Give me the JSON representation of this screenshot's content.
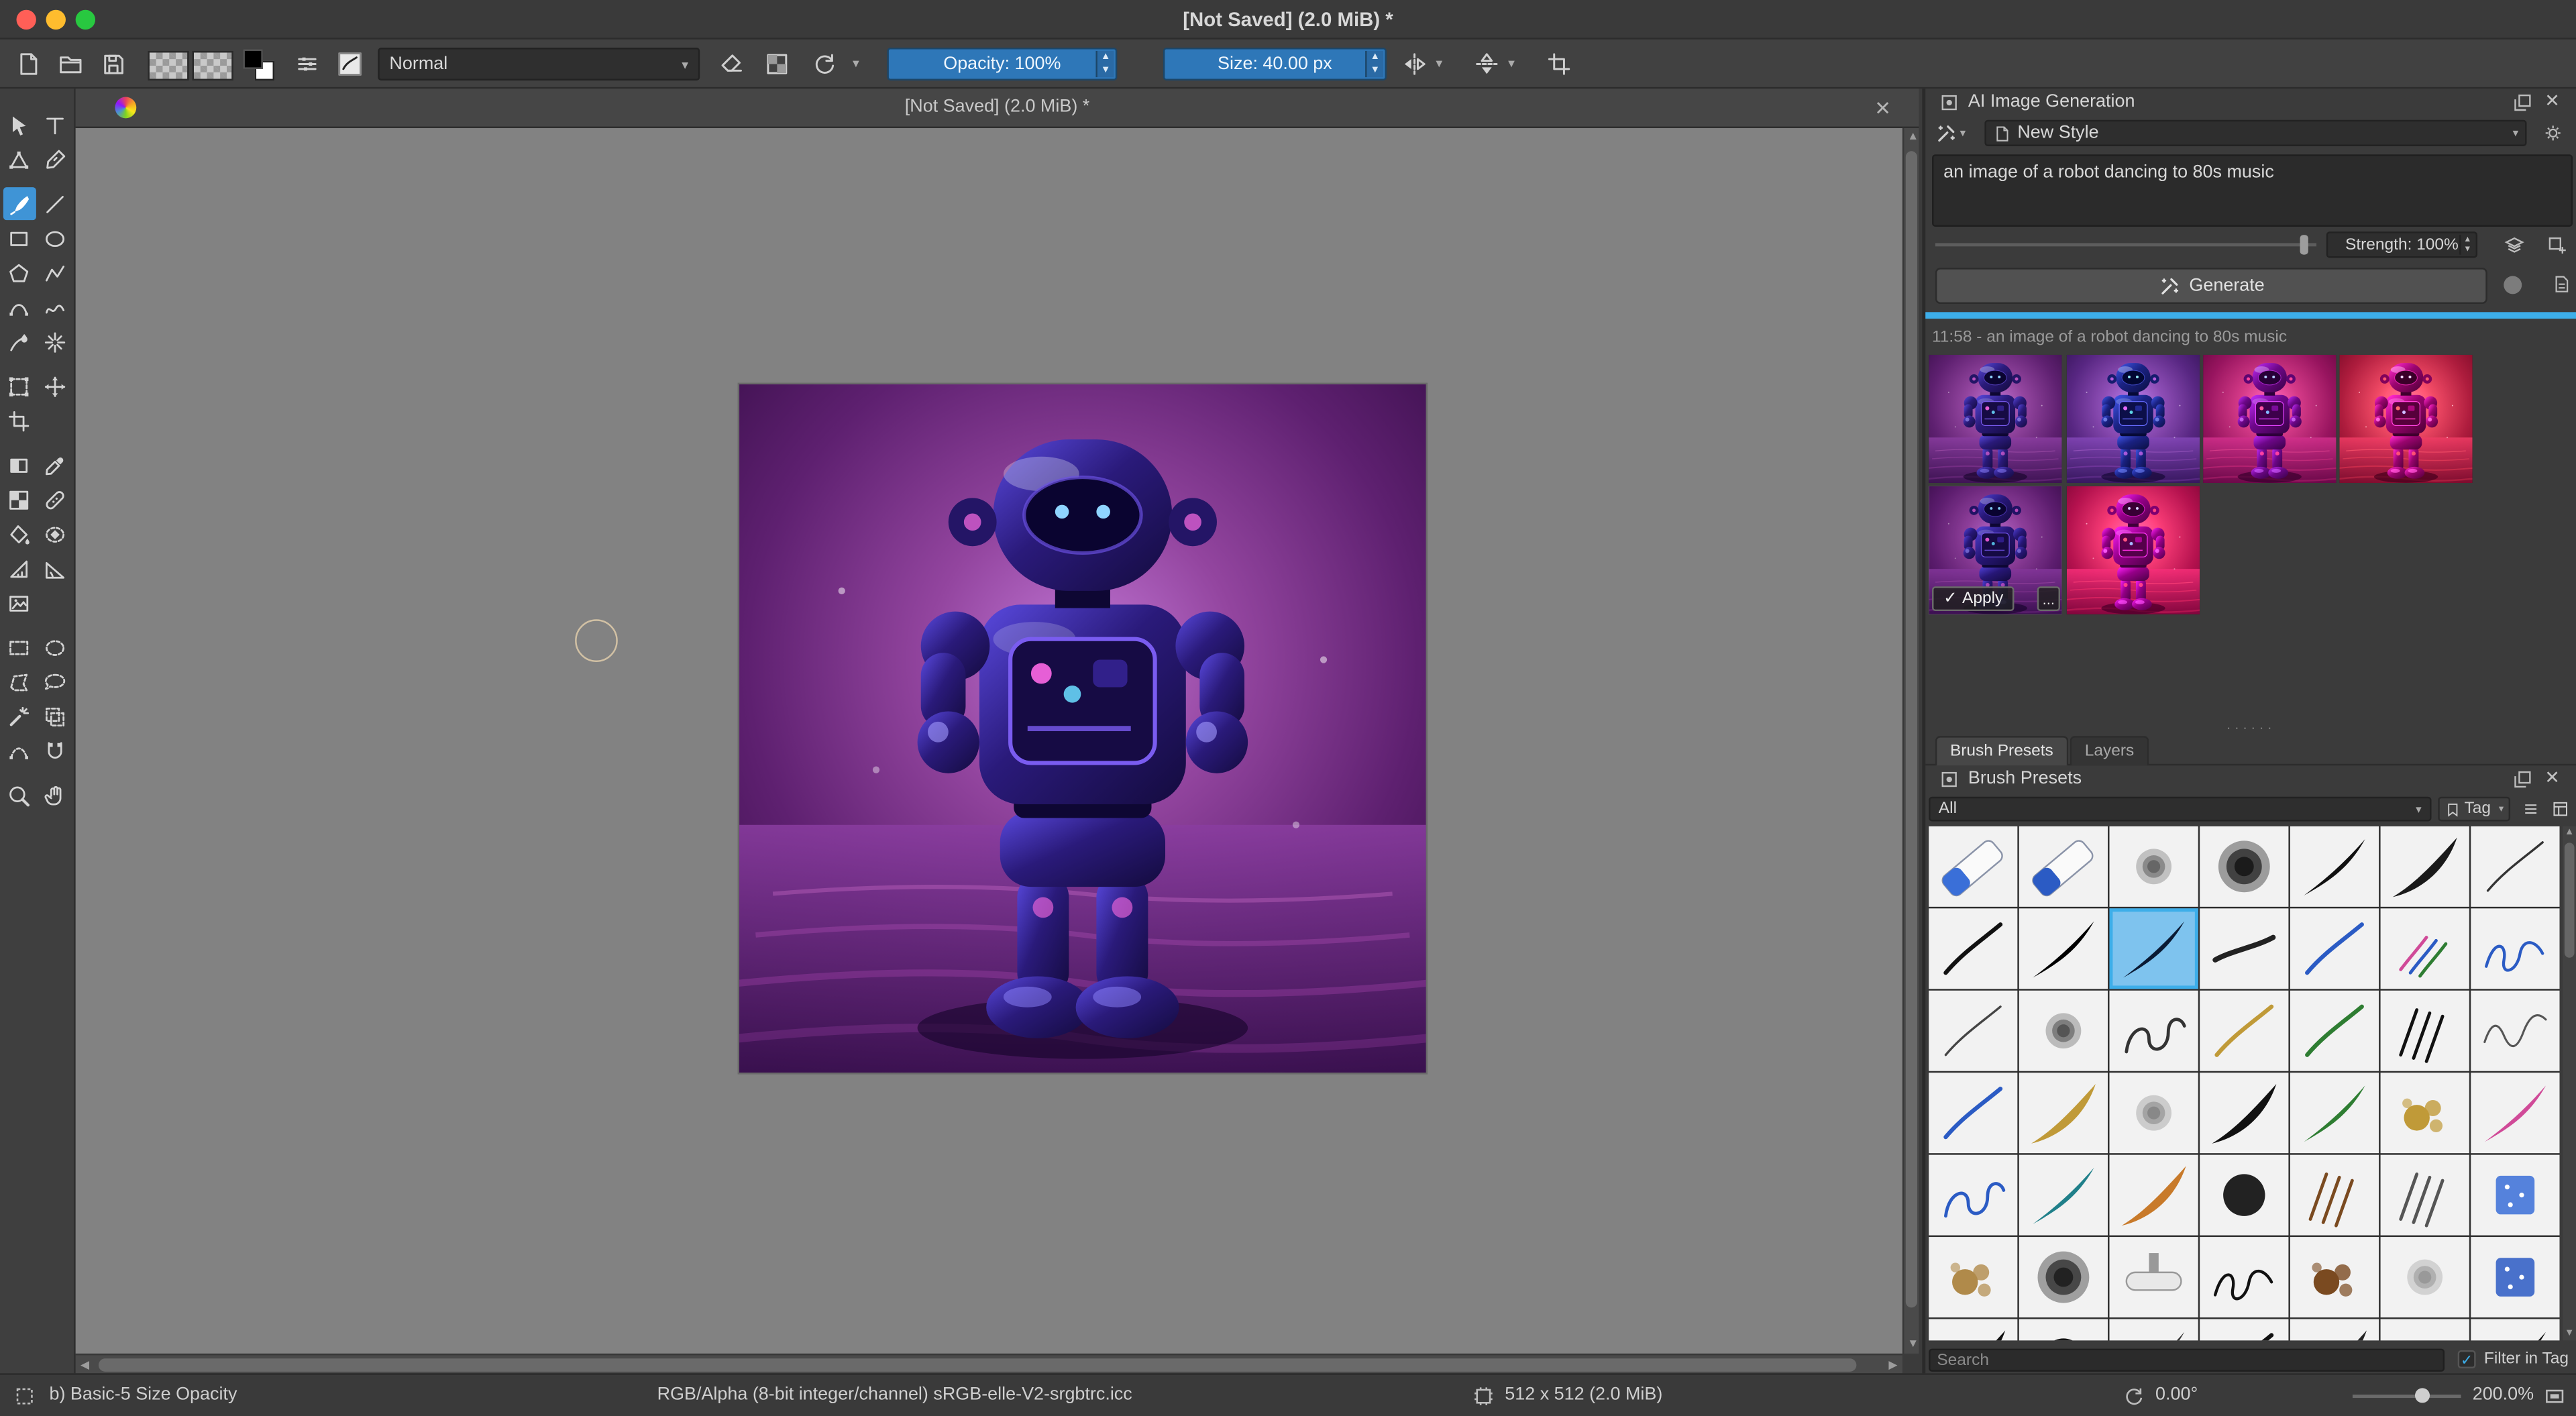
{
  "window": {
    "title": "[Not Saved]  (2.0 MiB) *"
  },
  "toolbar": {
    "blend_mode": "Normal",
    "opacity": "Opacity: 100%",
    "size": "Size: 40.00 px"
  },
  "subwindow": {
    "title": "[Not Saved]  (2.0 MiB) *"
  },
  "toolbox": {
    "tools": [
      [
        "select-shapes",
        "text"
      ],
      [
        "edit-shapes",
        "calligraphy"
      ],
      [
        "freehand-brush",
        "line"
      ],
      [
        "rectangle",
        "ellipse"
      ],
      [
        "polygon",
        "polyline"
      ],
      [
        "bezier-curve",
        "freehand-path"
      ],
      [
        "dynamic-brush",
        "multibrush"
      ],
      [
        "transform",
        "move"
      ],
      [
        "crop",
        null
      ],
      [
        "gradient",
        "color-sampler"
      ],
      [
        "pattern-edit",
        "smart-patch"
      ],
      [
        "fill",
        "enclose-fill"
      ],
      [
        "assistants",
        "measure"
      ],
      [
        "reference-images",
        null
      ],
      [
        "rect-select",
        "ellipse-select"
      ],
      [
        "polygon-select",
        "freehand-select"
      ],
      [
        "contiguous-select",
        "similar-select"
      ],
      [
        "bezier-select",
        "magnetic-select"
      ],
      [
        "zoom",
        "pan"
      ]
    ],
    "selected_tool": "freehand-brush"
  },
  "ai_panel": {
    "title": "AI Image Generation",
    "style_name": "New Style",
    "prompt": "an image of a robot dancing to 80s music",
    "strength": "Strength: 100%",
    "generate": "Generate",
    "history_label": "11:58 - an image of a robot dancing to 80s music",
    "apply": "Apply",
    "more": "...",
    "thumbnails": [
      {
        "variant": 1
      },
      {
        "variant": 2
      },
      {
        "variant": 3
      },
      {
        "variant": 4
      },
      {
        "variant": 5
      },
      {
        "variant": 6
      }
    ],
    "selected_thumbnail": 4
  },
  "docker_tabs": {
    "tab1": "Brush Presets",
    "tab2": "Layers"
  },
  "brush_docker": {
    "title": "Brush Presets",
    "filter_value": "All",
    "tag": "Tag",
    "search_placeholder": "Search",
    "filter_in_tag": "Filter in Tag",
    "grid": {
      "columns": 7,
      "rows": 7,
      "selected_index": 9
    }
  },
  "status_bar": {
    "preset": "b) Basic-5 Size Opacity",
    "profile": "RGB/Alpha (8-bit integer/channel)  sRGB-elle-V2-srgbtrc.icc",
    "dimensions": "512 x 512 (2.0 MiB)",
    "angle": "0.00°",
    "zoom": "200.0%"
  }
}
